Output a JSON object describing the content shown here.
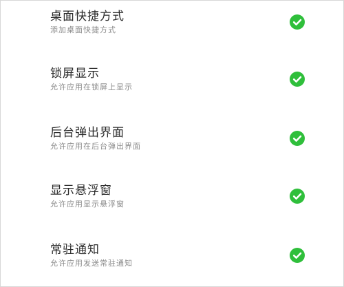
{
  "items": [
    {
      "title": "桌面快捷方式",
      "subtitle": "添加桌面快捷方式",
      "enabled": true,
      "icon": "check-circle-icon",
      "color": "#2fbf3b"
    },
    {
      "title": "锁屏显示",
      "subtitle": "允许应用在锁屏上显示",
      "enabled": true,
      "icon": "check-circle-icon",
      "color": "#2fbf3b"
    },
    {
      "title": "后台弹出界面",
      "subtitle": "允许应用在后台弹出界面",
      "enabled": true,
      "icon": "check-circle-icon",
      "color": "#2fbf3b"
    },
    {
      "title": "显示悬浮窗",
      "subtitle": "允许应用显示悬浮窗",
      "enabled": true,
      "icon": "check-circle-icon",
      "color": "#2fbf3b"
    },
    {
      "title": "常驻通知",
      "subtitle": "允许应用发送常驻通知",
      "enabled": true,
      "icon": "check-circle-icon",
      "color": "#2fbf3b"
    }
  ]
}
